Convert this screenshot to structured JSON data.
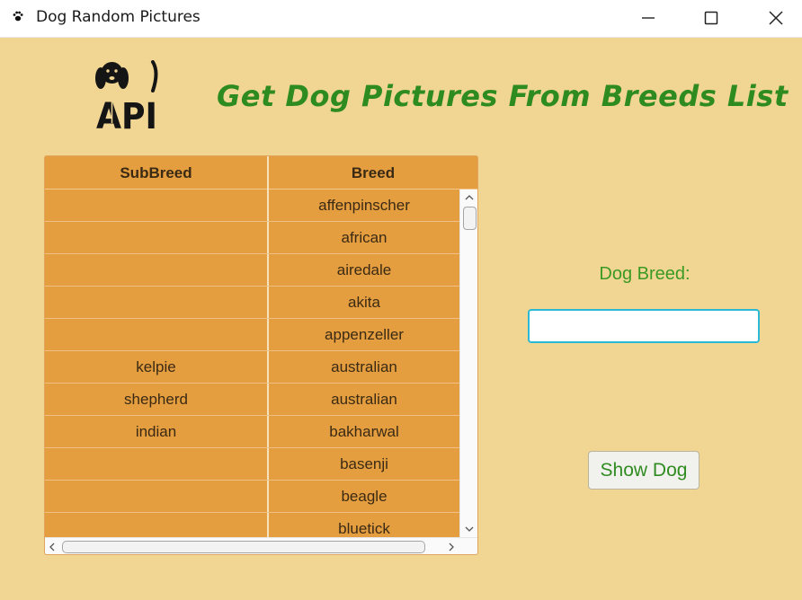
{
  "window": {
    "title": "Dog Random Pictures",
    "app_icon": "paw-icon",
    "controls": [
      "minimize-icon",
      "maximize-icon",
      "close-icon"
    ]
  },
  "header": {
    "logo_icon": "dog-api-logo",
    "logo_text": "API",
    "heading": "Get Dog Pictures From Breeds List"
  },
  "table": {
    "columns": {
      "subbreed": "SubBreed",
      "breed": "Breed"
    },
    "rows": [
      {
        "subbreed": "",
        "breed": "affenpinscher"
      },
      {
        "subbreed": "",
        "breed": "african"
      },
      {
        "subbreed": "",
        "breed": "airedale"
      },
      {
        "subbreed": "",
        "breed": "akita"
      },
      {
        "subbreed": "",
        "breed": "appenzeller"
      },
      {
        "subbreed": "kelpie",
        "breed": "australian"
      },
      {
        "subbreed": "shepherd",
        "breed": "australian"
      },
      {
        "subbreed": "indian",
        "breed": "bakharwal"
      },
      {
        "subbreed": "",
        "breed": "basenji"
      },
      {
        "subbreed": "",
        "breed": "beagle"
      },
      {
        "subbreed": "",
        "breed": "bluetick"
      }
    ]
  },
  "form": {
    "label": "Dog Breed:",
    "input_value": "",
    "button_label": "Show Dog"
  },
  "colors": {
    "background": "#f1d592",
    "table_background": "#e59e3f",
    "heading": "#2e8b1f",
    "input_focus": "#2ab8d5"
  }
}
